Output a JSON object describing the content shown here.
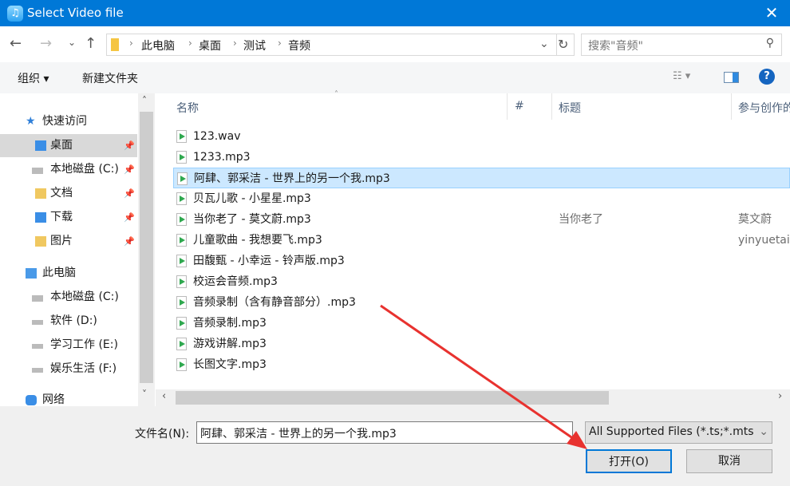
{
  "window": {
    "title": "Select Video file",
    "close_glyph": "✕"
  },
  "nav": {
    "back": "←",
    "forward": "→",
    "recent": "⌄",
    "up": "↑",
    "breadcrumb": [
      "此电脑",
      "桌面",
      "测试",
      "音频"
    ],
    "search_placeholder": "搜索\"音频\""
  },
  "toolbar": {
    "organize": "组织 ▾",
    "new_folder": "新建文件夹",
    "help": "?"
  },
  "sidebar": {
    "items": [
      {
        "label": "快速访问"
      },
      {
        "label": "桌面"
      },
      {
        "label": "本地磁盘 (C:)"
      },
      {
        "label": "文档"
      },
      {
        "label": "下载"
      },
      {
        "label": "图片"
      },
      {
        "label": "此电脑"
      },
      {
        "label": "本地磁盘 (C:)"
      },
      {
        "label": "软件 (D:)"
      },
      {
        "label": "学习工作 (E:)"
      },
      {
        "label": "娱乐生活 (F:)"
      },
      {
        "label": "网络"
      }
    ]
  },
  "columns": {
    "name": "名称",
    "number": "#",
    "title": "标题",
    "artist": "参与创作的"
  },
  "files": [
    {
      "name": "123.wav",
      "title": "",
      "artist": ""
    },
    {
      "name": "1233.mp3",
      "title": "",
      "artist": ""
    },
    {
      "name": "阿肆、郭采洁 - 世界上的另一个我.mp3",
      "title": "",
      "artist": ""
    },
    {
      "name": "贝瓦儿歌 - 小星星.mp3",
      "title": "",
      "artist": ""
    },
    {
      "name": "当你老了 - 莫文蔚.mp3",
      "title": "当你老了",
      "artist": "莫文蔚"
    },
    {
      "name": "儿童歌曲 - 我想要飞.mp3",
      "title": "",
      "artist": "yinyuetai"
    },
    {
      "name": "田馥甄 - 小幸运 - 铃声版.mp3",
      "title": "",
      "artist": ""
    },
    {
      "name": "校运会音频.mp3",
      "title": "",
      "artist": ""
    },
    {
      "name": "音频录制（含有静音部分）.mp3",
      "title": "",
      "artist": ""
    },
    {
      "name": "音频录制.mp3",
      "title": "",
      "artist": ""
    },
    {
      "name": "游戏讲解.mp3",
      "title": "",
      "artist": ""
    },
    {
      "name": "长图文字.mp3",
      "title": "",
      "artist": ""
    }
  ],
  "bottom": {
    "filename_label": "文件名(N):",
    "filename_value": "阿肆、郭采洁 - 世界上的另一个我.mp3",
    "filter": "All Supported Files (*.ts;*.mts",
    "open": "打开(O)",
    "cancel": "取消"
  },
  "colors": {
    "titlebar": "#0078d7",
    "selection": "#cce8ff",
    "annotation_arrow": "#e8322f"
  }
}
